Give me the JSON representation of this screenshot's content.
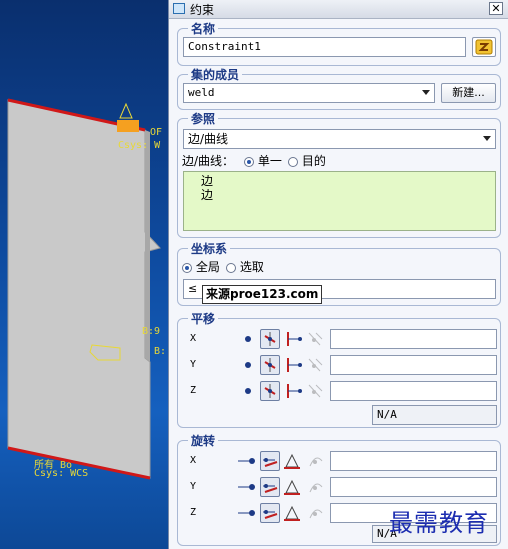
{
  "viewport": {
    "labels": {
      "of": "OF",
      "csys_top": "Csys: W",
      "b9": "B:9",
      "b": "B:",
      "bottom_prefix": "所有 Bo",
      "csys_bottom": "Csys: WCS"
    }
  },
  "dialog": {
    "title": "约束",
    "name_group": {
      "label": "名称",
      "value": "Constraint1"
    },
    "member_group": {
      "label": "集的成员",
      "selected": "weld",
      "new_button": "新建..."
    },
    "reference_group": {
      "label": "参照",
      "type_selected": "边/曲线",
      "edge_label": "边/曲线：",
      "radio_single": "单一",
      "radio_target": "目的",
      "items": [
        "边",
        "边"
      ]
    },
    "csys_group": {
      "label": "坐标系",
      "radio_global": "全局",
      "radio_select": "选取",
      "value": "≤"
    },
    "translation_group": {
      "label": "平移",
      "axes": [
        "X",
        "Y",
        "Z"
      ],
      "na": "N/A"
    },
    "rotation_group": {
      "label": "旋转",
      "axes": [
        "X",
        "Y",
        "Z"
      ],
      "na": "N/A"
    }
  },
  "tooltip": "来源proe123.com",
  "watermark": "最需教育"
}
